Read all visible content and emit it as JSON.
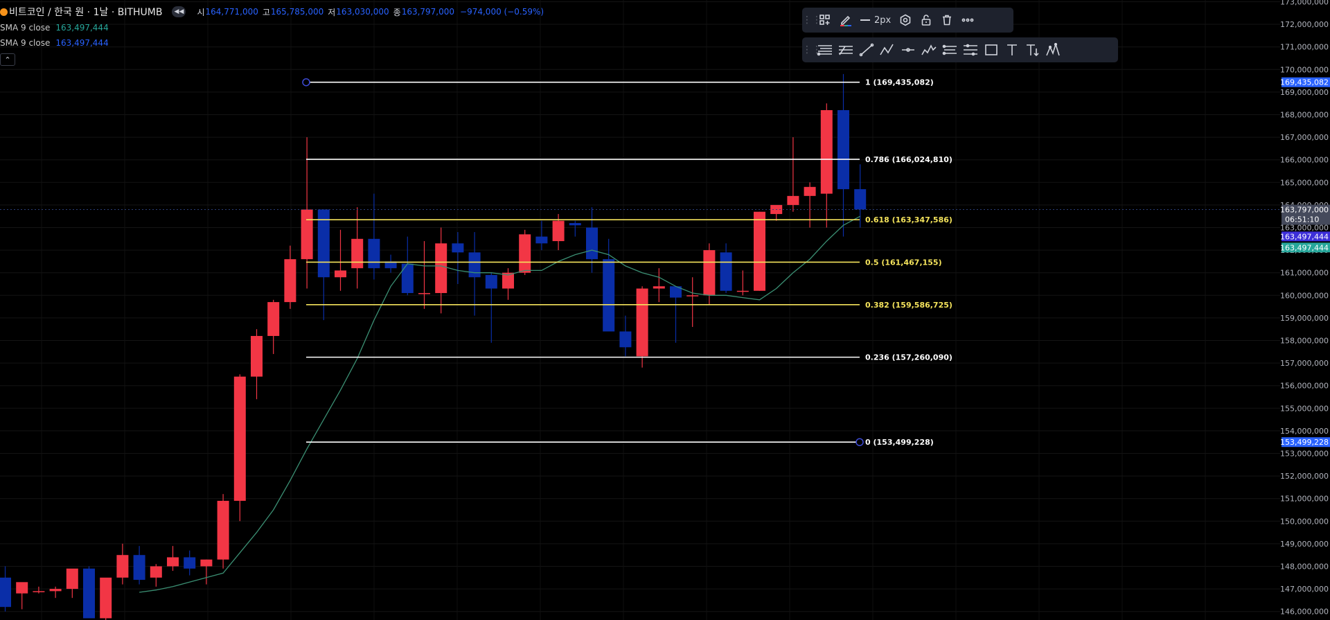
{
  "symbol": {
    "title": "비트코인 / 한국 원 · 1날 · BITHUMB",
    "open_label": "시",
    "open": "164,771,000",
    "high_label": "고",
    "high": "165,785,000",
    "low_label": "저",
    "low": "163,030,000",
    "close_label": "종",
    "close": "163,797,000",
    "change": "−974,000 (−0.59%)"
  },
  "indicators": [
    {
      "name": "SMA 9 close",
      "value": "163,497,444",
      "color": "#26a69a"
    },
    {
      "name": "SMA 9 close",
      "value": "163,497,444",
      "color": "#2962ff"
    }
  ],
  "colors": {
    "up": "#f23645",
    "down": "#0a2ea8",
    "fib_white": "#ffffff",
    "fib_yellow": "#f5e45c",
    "sma": "#3b8f73",
    "handle": "#3d4bd6",
    "axis_text": "#b2b5be",
    "badge_blue": "#2962ff",
    "badge_indigo": "#3d2fd9",
    "badge_green": "#26a69a",
    "badge_gray": "#454a5c"
  },
  "toolbar_top": [
    {
      "icon": "grip-icon"
    },
    {
      "icon": "template-icon"
    },
    {
      "icon": "pencil-color-icon"
    },
    {
      "icon": "line-width-icon",
      "label": "2px"
    },
    {
      "icon": "settings-icon"
    },
    {
      "icon": "lock-icon"
    },
    {
      "icon": "trash-icon"
    },
    {
      "icon": "more-icon"
    }
  ],
  "toolbar_tools": [
    "fib-retracement-icon",
    "trend-based-fib-icon",
    "trend-line-icon",
    "abcd-pattern-icon",
    "horizontal-ray-icon",
    "elliott-wave-icon",
    "parallel-channel-icon",
    "pitchfork-icon",
    "rectangle-icon",
    "text-icon",
    "anchored-text-icon",
    "pattern-icon"
  ],
  "chart_data": {
    "type": "candlestick",
    "y_axis": {
      "range": [
        145500000,
        173500000
      ],
      "ticks": [
        "146,000,000",
        "147,000,000",
        "148,000,000",
        "149,000,000",
        "150,000,000",
        "151,000,000",
        "152,000,000",
        "153,000,000",
        "154,000,000",
        "155,000,000",
        "156,000,000",
        "157,000,000",
        "158,000,000",
        "159,000,000",
        "160,000,000",
        "161,000,000",
        "162,000,000",
        "163,000,000",
        "164,000,000",
        "165,000,000",
        "166,000,000",
        "167,000,000",
        "168,000,000",
        "169,000,000",
        "170,000,000",
        "171,000,000",
        "172,000,000",
        "173,000,000"
      ]
    },
    "candles": [
      [
        147500000,
        148000000,
        146000000,
        146200000
      ],
      [
        146800000,
        147200000,
        146100000,
        147300000
      ],
      [
        146900000,
        147100000,
        146800000,
        146900000
      ],
      [
        146900000,
        147100000,
        146600000,
        147000000
      ],
      [
        147000000,
        147800000,
        146600000,
        147900000
      ],
      [
        147900000,
        148000000,
        146500000,
        145700000
      ],
      [
        145700000,
        146300000,
        145400000,
        147500000
      ],
      [
        147500000,
        149000000,
        147200000,
        148500000
      ],
      [
        148500000,
        148900000,
        147200000,
        147400000
      ],
      [
        147500000,
        148100000,
        147100000,
        148000000
      ],
      [
        148000000,
        148900000,
        147800000,
        148400000
      ],
      [
        148400000,
        148700000,
        147600000,
        147900000
      ],
      [
        148000000,
        148300000,
        147200000,
        148300000
      ],
      [
        148300000,
        151200000,
        147900000,
        150900000
      ],
      [
        150900000,
        156500000,
        150000000,
        156400000
      ],
      [
        156400000,
        158500000,
        155400000,
        158200000
      ],
      [
        158200000,
        159800000,
        157400000,
        159700000
      ],
      [
        159700000,
        162200000,
        159400000,
        161600000
      ],
      [
        161600000,
        167000000,
        160300000,
        163800000
      ],
      [
        163800000,
        163800000,
        158900000,
        160800000
      ],
      [
        160800000,
        162900000,
        160200000,
        161100000
      ],
      [
        161200000,
        163900000,
        160300000,
        162500000
      ],
      [
        162500000,
        164500000,
        160700000,
        161200000
      ],
      [
        161500000,
        161800000,
        161000000,
        161200000
      ],
      [
        161400000,
        162600000,
        160000000,
        160100000
      ],
      [
        160100000,
        162400000,
        159400000,
        160100000
      ],
      [
        160100000,
        163000000,
        159200000,
        162300000
      ],
      [
        162300000,
        162800000,
        160500000,
        161900000
      ],
      [
        161900000,
        162800000,
        159100000,
        160800000
      ],
      [
        160900000,
        161000000,
        157900000,
        160300000
      ],
      [
        160300000,
        161200000,
        159800000,
        161000000
      ],
      [
        161000000,
        162900000,
        160900000,
        162700000
      ],
      [
        162600000,
        163300000,
        162000000,
        162300000
      ],
      [
        162400000,
        163600000,
        162000000,
        163300000
      ],
      [
        163200000,
        163300000,
        162600000,
        163100000
      ],
      [
        163000000,
        163900000,
        161000000,
        161600000
      ],
      [
        161600000,
        162500000,
        158600000,
        158400000
      ],
      [
        158400000,
        159100000,
        157300000,
        157700000
      ],
      [
        157300000,
        160400000,
        156800000,
        160300000
      ],
      [
        160300000,
        161200000,
        159700000,
        160400000
      ],
      [
        160400000,
        160400000,
        157900000,
        159900000
      ],
      [
        160000000,
        160800000,
        158600000,
        160000000
      ],
      [
        160000000,
        162300000,
        159600000,
        162000000
      ],
      [
        161900000,
        162300000,
        160100000,
        160200000
      ],
      [
        160200000,
        161100000,
        160000000,
        160200000
      ],
      [
        160200000,
        163700000,
        160200000,
        163700000
      ],
      [
        163600000,
        163700000,
        163300000,
        164000000
      ],
      [
        164000000,
        167000000,
        163700000,
        164400000
      ],
      [
        164400000,
        165000000,
        163000000,
        164800000
      ],
      [
        164500000,
        168500000,
        163000000,
        168200000
      ],
      [
        168200000,
        169800000,
        162600000,
        164700000
      ],
      [
        164700000,
        165800000,
        163000000,
        163800000
      ]
    ],
    "sma": [
      null,
      null,
      null,
      null,
      null,
      null,
      null,
      null,
      146850000,
      146950000,
      147100000,
      147300000,
      147500000,
      147700000,
      148600000,
      149500000,
      150500000,
      151800000,
      153200000,
      154500000,
      155800000,
      157200000,
      158900000,
      160400000,
      161400000,
      161300000,
      161300000,
      161100000,
      161000000,
      161000000,
      160900000,
      161100000,
      161100000,
      161500000,
      161800000,
      162000000,
      161800000,
      161300000,
      161000000,
      160800000,
      160400000,
      160100000,
      160000000,
      160000000,
      159900000,
      159800000,
      160300000,
      161000000,
      161600000,
      162400000,
      163100000,
      163500000
    ],
    "fib_levels": [
      {
        "label": "1 (169,435,082)",
        "value": 169435082,
        "color": "#ffffff"
      },
      {
        "label": "0.786 (166,024,810)",
        "value": 166024810,
        "color": "#ffffff"
      },
      {
        "label": "0.618 (163,347,586)",
        "value": 163347586,
        "color": "#f5e45c"
      },
      {
        "label": "0.5 (161,467,155)",
        "value": 161467155,
        "color": "#f5e45c"
      },
      {
        "label": "0.382 (159,586,725)",
        "value": 159586725,
        "color": "#f5e45c"
      },
      {
        "label": "0.236 (157,260,090)",
        "value": 157260090,
        "color": "#ffffff"
      },
      {
        "label": "0 (153,499,228)",
        "value": 153499228,
        "color": "#ffffff"
      }
    ],
    "price_badges": [
      {
        "text": "169,435,082",
        "value": 169435082,
        "color": "#2962ff"
      },
      {
        "text": "163,797,000",
        "value": 163797000,
        "color": "#454a5c",
        "sub": "06:51:10"
      },
      {
        "text": "163,497,444",
        "value": 163497444,
        "color": "#3d2fd9",
        "offset": 1
      },
      {
        "text": "163,497,444",
        "value": 163497444,
        "color": "#26a69a",
        "offset": 2
      },
      {
        "text": "153,499,228",
        "value": 153499228,
        "color": "#2962ff"
      }
    ]
  }
}
